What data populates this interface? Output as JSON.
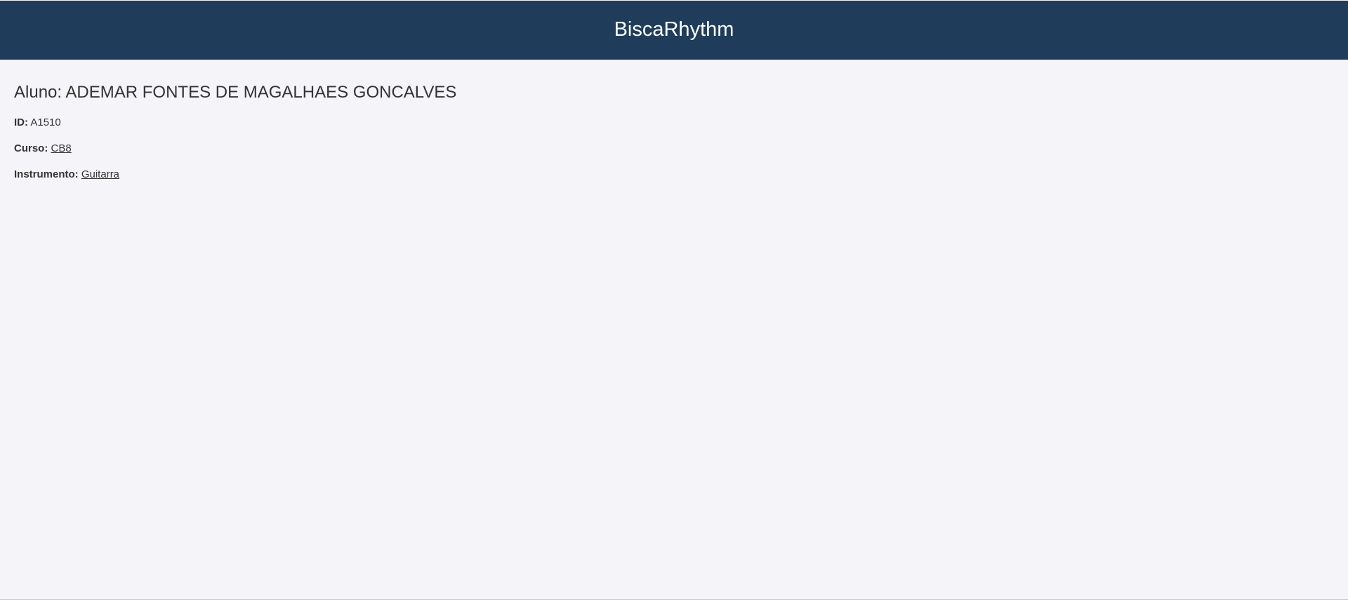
{
  "header": {
    "brand": "BiscaRhythm"
  },
  "student": {
    "heading": "Aluno: ADEMAR FONTES DE MAGALHAES GONCALVES",
    "id_label": "ID:",
    "id_value": "A1510",
    "course_label": "Curso:",
    "course_value": "CB8",
    "instrument_label": "Instrumento:",
    "instrument_value": "Guitarra"
  },
  "colors": {
    "header_background": "#1f3d5b",
    "page_background": "#f4f4f9",
    "text": "#333333",
    "header_text": "#ffffff"
  }
}
